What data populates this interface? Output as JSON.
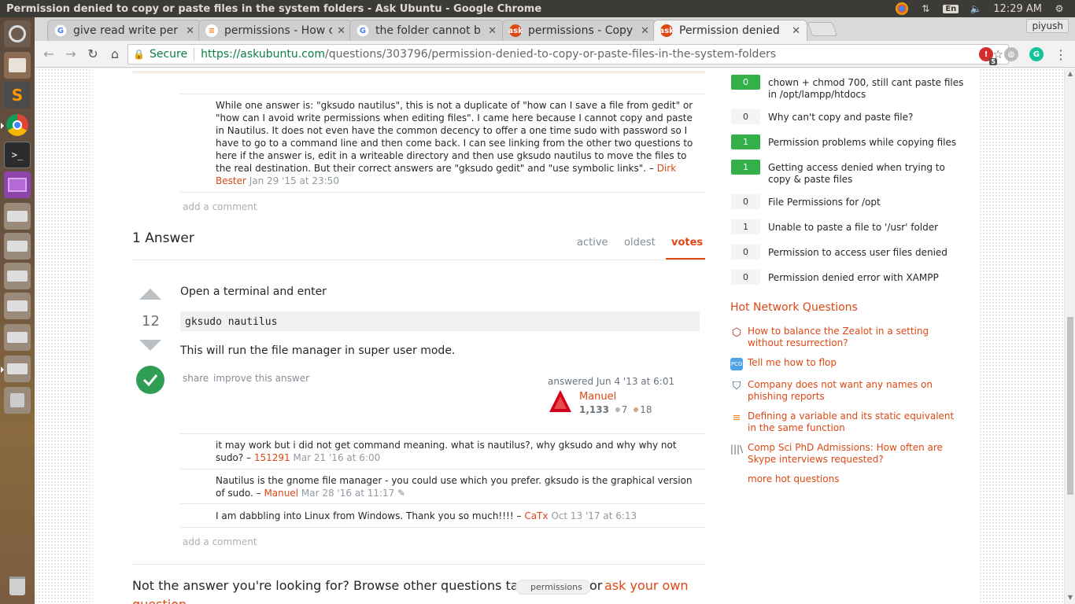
{
  "os_panel": {
    "window_title": "Permission denied to copy or paste files in the system folders - Ask Ubuntu - Google Chrome",
    "keyboard": "En",
    "time": "12:29 AM"
  },
  "browser": {
    "tabs": [
      {
        "label": "give read write per",
        "favicon": "google-icon"
      },
      {
        "label": "permissions - How c",
        "favicon": "stackoverflow-icon"
      },
      {
        "label": "the folder cannot b",
        "favicon": "google-icon"
      },
      {
        "label": "permissions - Copy",
        "favicon": "askubuntu-icon"
      },
      {
        "label": "Permission denied",
        "favicon": "askubuntu-icon"
      }
    ],
    "profile": "piyush",
    "secure_label": "Secure",
    "url_scheme_host": "https://askubuntu.com",
    "url_path": "/questions/303796/permission-denied-to-copy-or-paste-files-in-the-system-folders",
    "ext_badge": "5"
  },
  "question_comment": {
    "text": "While one answer is: \"gksudo nautilus\", this is not a duplicate of \"how can I save a file from gedit\" or \"how can I avoid write permissions when editing files\". I came here because I cannot copy and paste in Nautilus. It does not even have the common decency to offer a one time sudo with password so I have to go to a command line and then come back. I can see linking from the other two questions to here if the answer is, edit in a writeable directory and then use gksudo nautilus to move the files to the real destination. But their correct answers are \"gksudo gedit\" and \"use symbolic links\". –",
    "author": "Dirk Bester",
    "date": "Jan 29 '15 at 23:50"
  },
  "add_comment_label": "add a comment",
  "answers_header": {
    "count_label": "1 Answer",
    "sort_tabs": [
      "active",
      "oldest",
      "votes"
    ],
    "active_sort": "votes"
  },
  "answer": {
    "score": "12",
    "body_intro": "Open a terminal and enter",
    "code": "gksudo nautilus",
    "body_outro": "This will run the file manager in super user mode.",
    "share_label": "share",
    "improve_label": "improve this answer",
    "answered_label": "answered Jun 4 '13 at 6:01",
    "user_name": "Manuel",
    "reputation": "1,133",
    "silver": "7",
    "bronze": "18"
  },
  "answer_comments": [
    {
      "text": "it may work but i did not get command meaning. what is nautilus?, why gksudo and why why not sudo? –",
      "author": "151291",
      "date": "Mar 21 '16 at 6:00"
    },
    {
      "text": "Nautilus is the gnome file manager - you could use which you prefer. gksudo is the graphical version of sudo. –",
      "author": "Manuel",
      "date": "Mar 28 '16 at 11:17"
    },
    {
      "text": "I am dabbling into Linux from Windows. Thank you so much!!!! –",
      "author": "CaTx",
      "date": "Oct 13 '17 at 6:13"
    }
  ],
  "footer_prompt": {
    "lead": "Not the answer you're looking for? Browse other questions tagged",
    "tag": "permissions",
    "or": "or",
    "ask_link": "ask your own",
    "ask_link_cont": "question."
  },
  "related": [
    {
      "score": "0",
      "title": "chown + chmod 700, still cant paste files in /opt/lampp/htdocs",
      "answered": true
    },
    {
      "score": "0",
      "title": "Why can't copy and paste file?",
      "answered": false
    },
    {
      "score": "1",
      "title": "Permission problems while copying files",
      "answered": true
    },
    {
      "score": "1",
      "title": "Getting access denied when trying to copy & paste files",
      "answered": true
    },
    {
      "score": "0",
      "title": "File Permissions for /opt",
      "answered": false
    },
    {
      "score": "1",
      "title": "Unable to paste a file to '/usr' folder",
      "answered": false
    },
    {
      "score": "0",
      "title": "Permission to access user files denied",
      "answered": false
    },
    {
      "score": "0",
      "title": "Permission denied error with XAMPP",
      "answered": false
    }
  ],
  "hot_network": {
    "heading": "Hot Network Questions",
    "items": [
      {
        "title": "How to balance the Zealot in a setting without resurrection?",
        "icon": "rpg-icon"
      },
      {
        "title": "Tell me how to flop",
        "icon": "codegolf-icon"
      },
      {
        "title": "Company does not want any names on phishing reports",
        "icon": "security-icon"
      },
      {
        "title": "Defining a variable and its static equivalent in the same function",
        "icon": "stackoverflow-icon"
      },
      {
        "title": "Comp Sci PhD Admissions: How often are Skype interviews requested?",
        "icon": "academia-icon"
      }
    ],
    "more": "more hot questions"
  },
  "colors": {
    "accent": "#dd4814",
    "accepted": "#2f9e54",
    "answered_badge": "#34b049"
  }
}
